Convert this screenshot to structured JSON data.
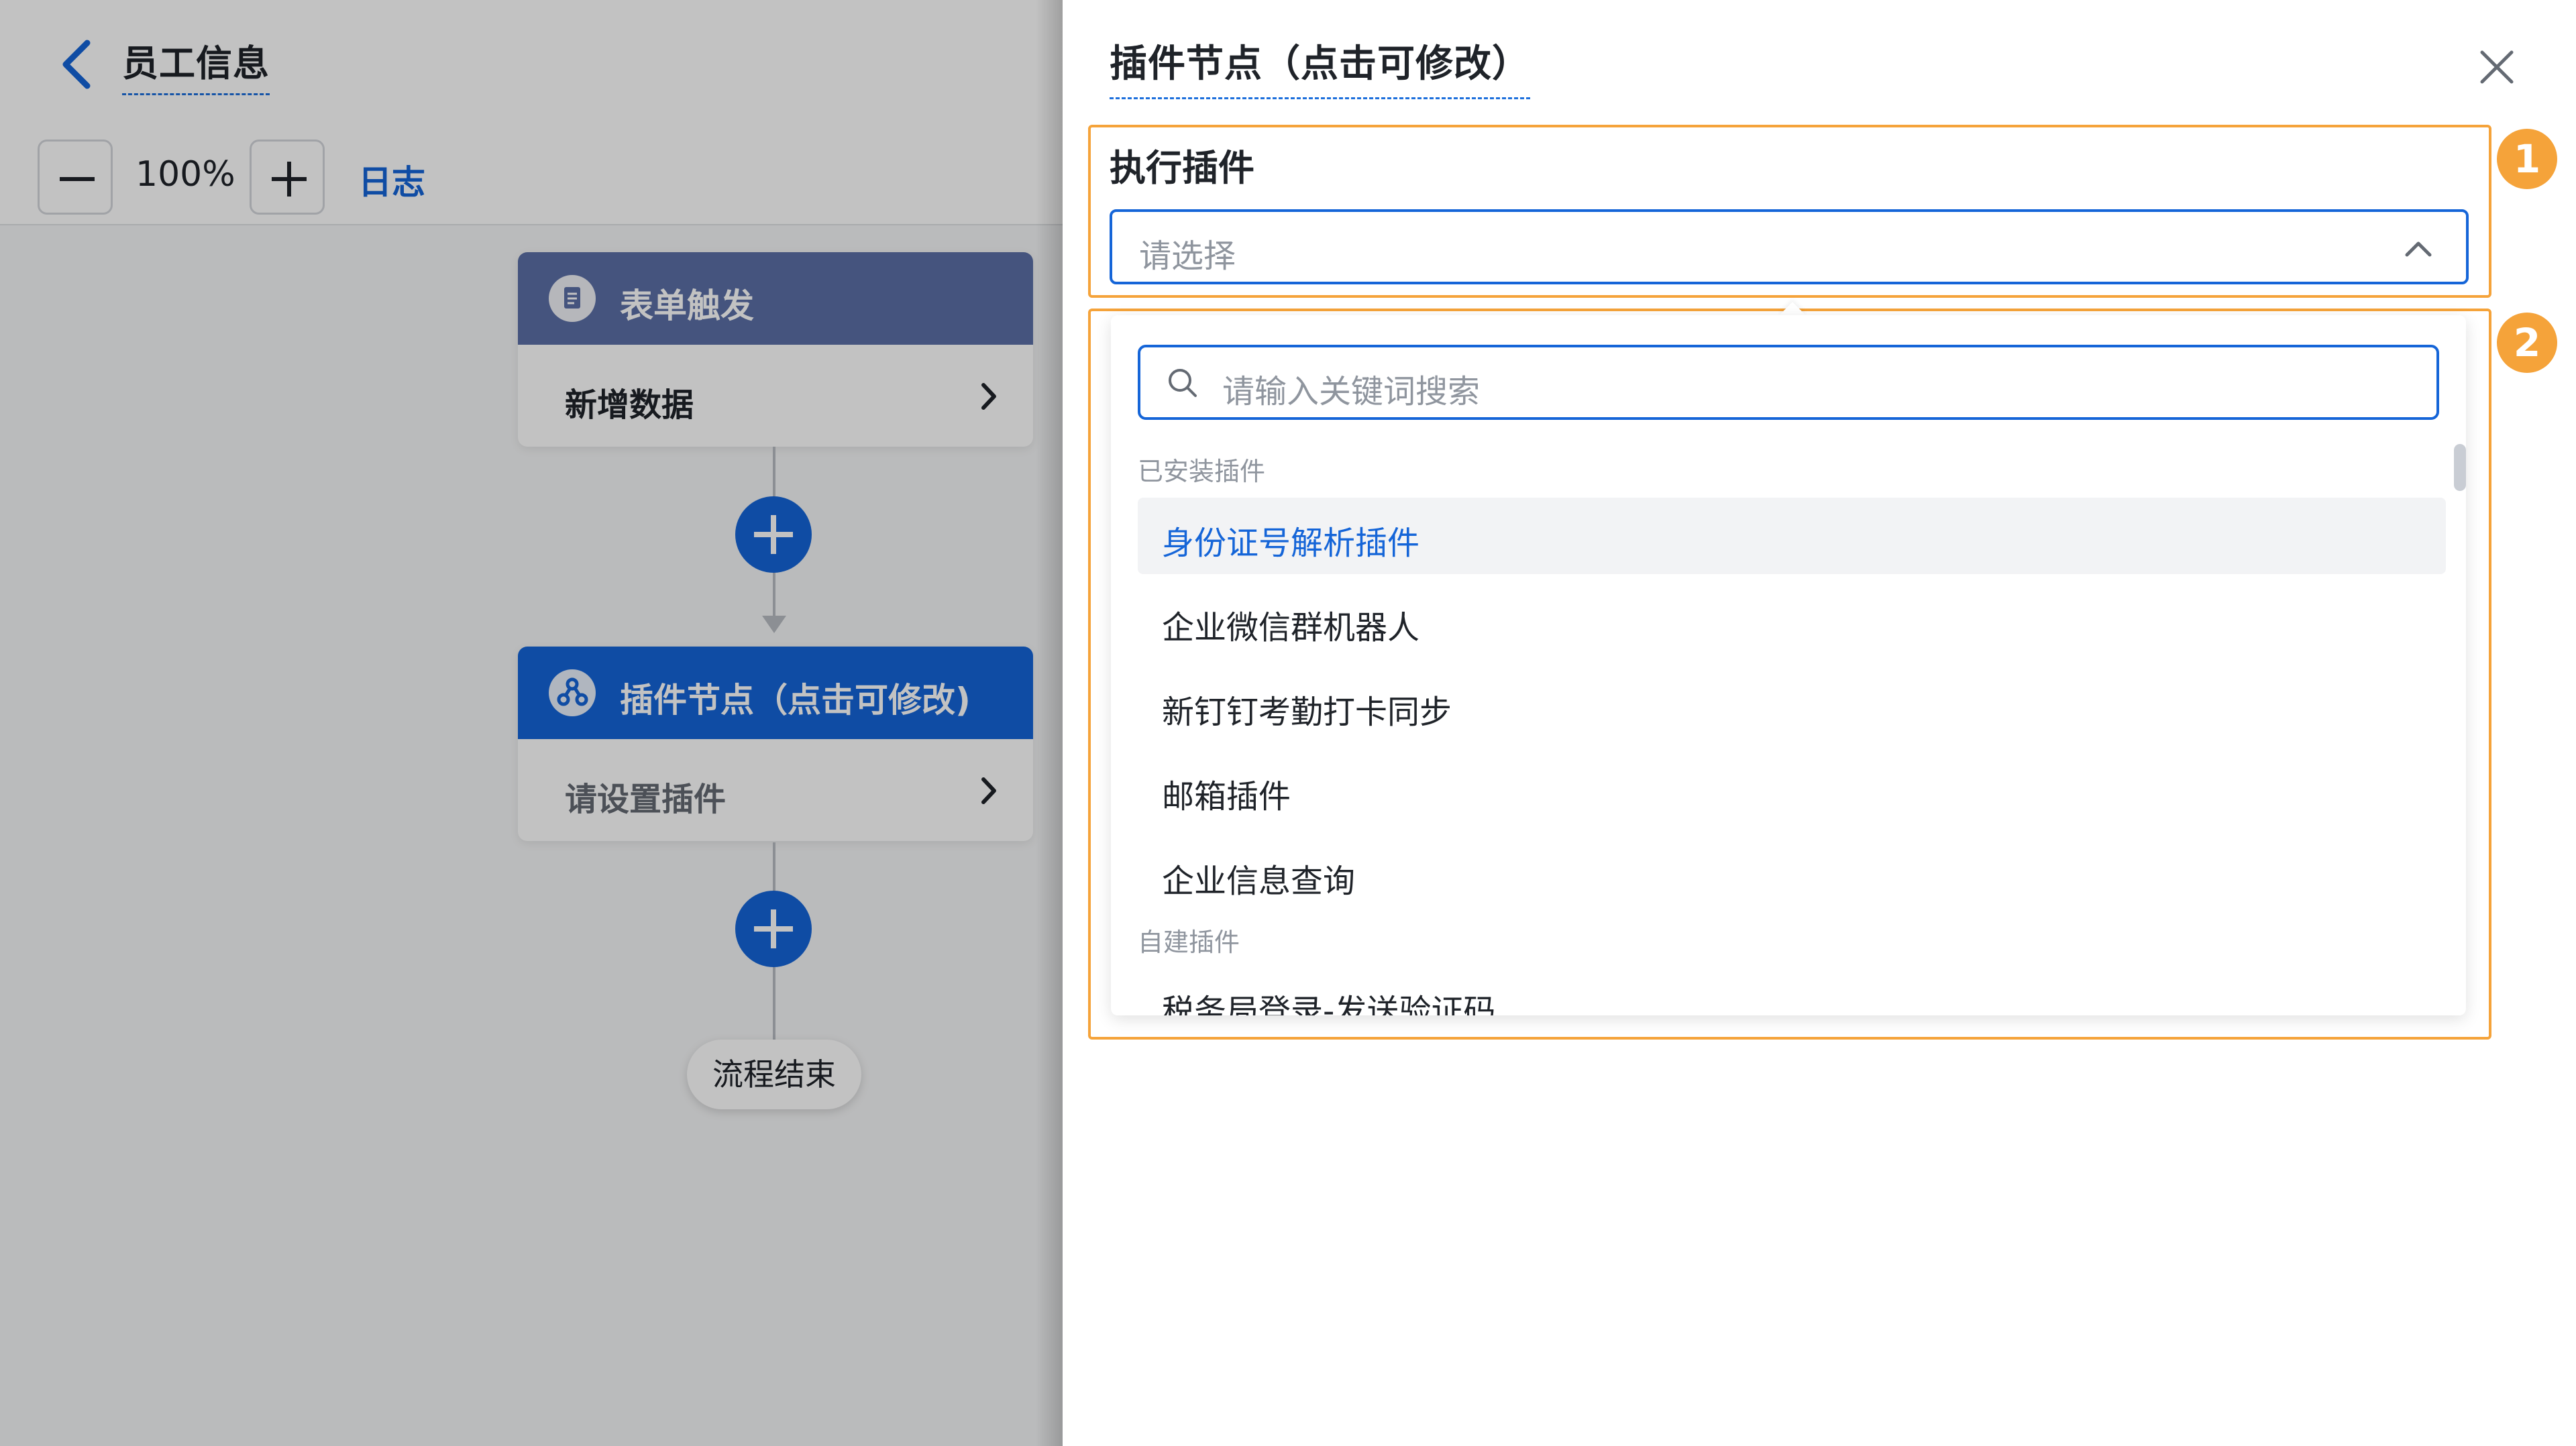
{
  "header": {
    "title": "员工信息"
  },
  "toolbar": {
    "zoom": "100%",
    "log_label": "日志"
  },
  "flow": {
    "nodes": [
      {
        "title": "表单触发",
        "body": "新增数据",
        "header_color": "#5b6fa6"
      },
      {
        "title": "插件节点（点击可修改)",
        "body": "请设置插件",
        "header_color": "#1565d8"
      }
    ],
    "end_label": "流程结束"
  },
  "panel": {
    "title": "插件节点（点击可修改）",
    "field_label": "执行插件",
    "select_placeholder": "请选择",
    "search_placeholder": "请输入关键词搜索",
    "badges": [
      "1",
      "2"
    ],
    "groups": [
      {
        "label": "已安装插件",
        "items": [
          "身份证号解析插件",
          "企业微信群机器人",
          "新钉钉考勤打卡同步",
          "邮箱插件",
          "企业信息查询"
        ]
      },
      {
        "label": "自建插件",
        "items": [
          "税务局登录-发送验证码"
        ]
      }
    ]
  },
  "colors": {
    "accent": "#1565d8",
    "highlight": "#f5a33a"
  }
}
